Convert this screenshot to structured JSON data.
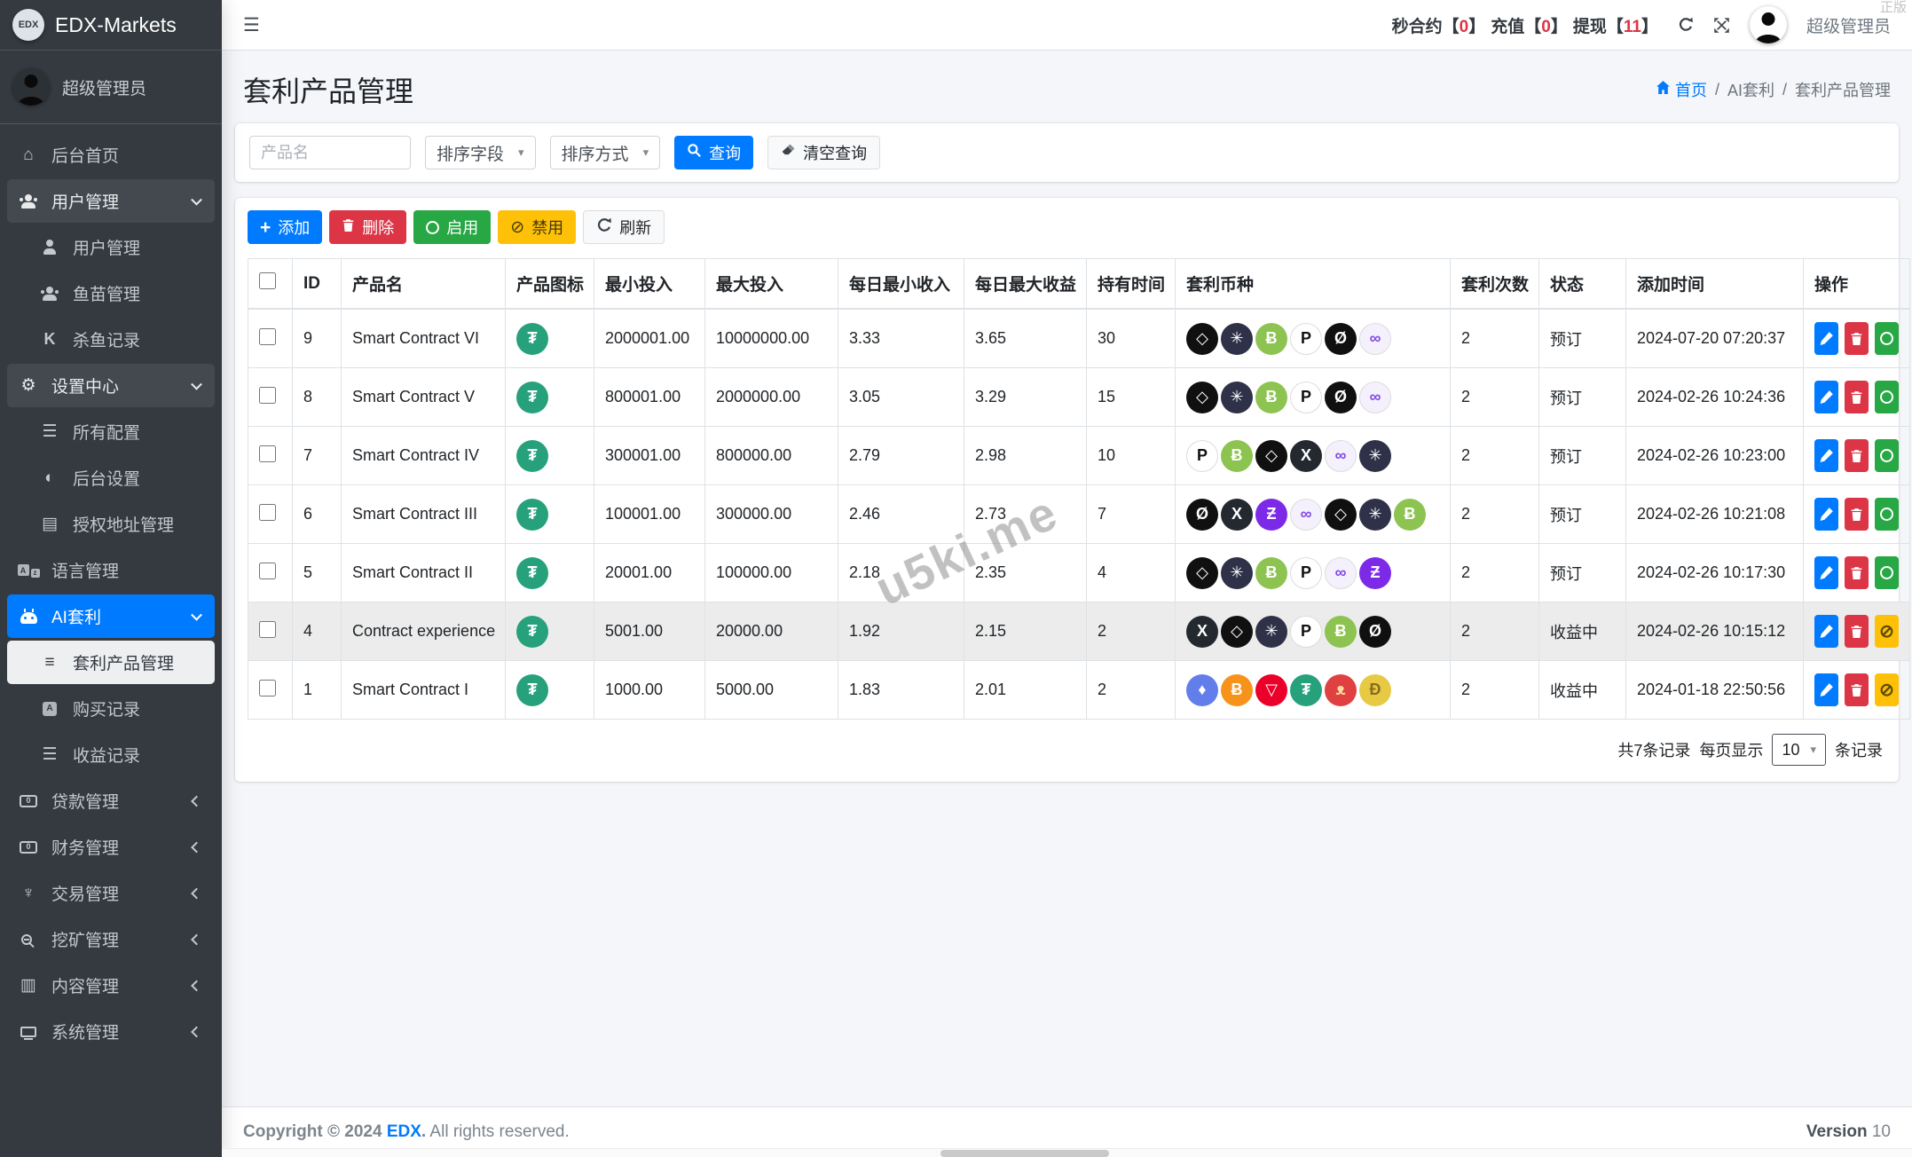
{
  "sidebar": {
    "brand": {
      "logo": "EDX",
      "name": "EDX-Markets"
    },
    "user": "超级管理员",
    "items": [
      {
        "label": "后台首页",
        "icon": "home"
      },
      {
        "label": "用户管理",
        "icon": "people",
        "expanded": true,
        "children": [
          {
            "label": "用户管理",
            "icon": "person"
          },
          {
            "label": "鱼苗管理",
            "icon": "people"
          },
          {
            "label": "杀鱼记录",
            "icon": "k"
          }
        ]
      },
      {
        "label": "设置中心",
        "icon": "gear",
        "expanded": true,
        "children": [
          {
            "label": "所有配置",
            "icon": "thlist"
          },
          {
            "label": "后台设置",
            "icon": "adjust"
          },
          {
            "label": "授权地址管理",
            "icon": "card"
          }
        ]
      },
      {
        "label": "语言管理",
        "icon": "lang"
      },
      {
        "label": "AI套利",
        "icon": "robot",
        "expanded": true,
        "active": true,
        "children": [
          {
            "label": "套利产品管理",
            "icon": "lines",
            "active": true
          },
          {
            "label": "购买记录",
            "icon": "abox"
          },
          {
            "label": "收益记录",
            "icon": "listdots"
          }
        ]
      },
      {
        "label": "贷款管理",
        "icon": "money",
        "collapsed": true
      },
      {
        "label": "财务管理",
        "icon": "money",
        "collapsed": true
      },
      {
        "label": "交易管理",
        "icon": "trident",
        "collapsed": true
      },
      {
        "label": "挖矿管理",
        "icon": "mag",
        "collapsed": true
      },
      {
        "label": "内容管理",
        "icon": "news",
        "collapsed": true
      },
      {
        "label": "系统管理",
        "icon": "desktop",
        "collapsed": true
      }
    ]
  },
  "topbar": {
    "stats": [
      {
        "label": "秒合约",
        "value": "0"
      },
      {
        "label": "充值",
        "value": "0"
      },
      {
        "label": "提现",
        "value": "11"
      }
    ],
    "username": "超级管理员"
  },
  "watermarks": {
    "corner": "正版",
    "table": "u5ki.me"
  },
  "page": {
    "title": "套利产品管理",
    "breadcrumb": {
      "home": "首页",
      "section": "AI套利",
      "current": "套利产品管理"
    }
  },
  "filters": {
    "product_placeholder": "产品名",
    "sort_field": "排序字段",
    "sort_order": "排序方式",
    "search_label": "查询",
    "clear_label": "清空查询"
  },
  "toolbar": {
    "add": "添加",
    "delete": "删除",
    "enable": "启用",
    "disable": "禁用",
    "refresh": "刷新"
  },
  "table": {
    "headers": [
      "ID",
      "产品名",
      "产品图标",
      "最小投入",
      "最大投入",
      "每日最小收入",
      "每日最大收益",
      "持有时间",
      "套利币种",
      "套利次数",
      "状态",
      "添加时间",
      "操作"
    ],
    "product_icon": "usdt",
    "rows": [
      {
        "id": "9",
        "name": "Smart Contract VI",
        "min": "2000001.00",
        "max": "10000000.00",
        "daily_min": "3.33",
        "daily_max": "3.65",
        "hold": "30",
        "coins": [
          "eos",
          "atom",
          "bch",
          "dot",
          "xlm",
          "matic"
        ],
        "count": "2",
        "status": "预订",
        "toggle": "enable",
        "added": "2024-07-20 07:20:37",
        "highlight": false
      },
      {
        "id": "8",
        "name": "Smart Contract V",
        "min": "800001.00",
        "max": "2000000.00",
        "daily_min": "3.05",
        "daily_max": "3.29",
        "hold": "15",
        "coins": [
          "eos",
          "atom",
          "bch",
          "dot",
          "xlm",
          "matic"
        ],
        "count": "2",
        "status": "预订",
        "toggle": "enable",
        "added": "2024-02-26 10:24:36",
        "highlight": false
      },
      {
        "id": "7",
        "name": "Smart Contract IV",
        "min": "300001.00",
        "max": "800000.00",
        "daily_min": "2.79",
        "daily_max": "2.98",
        "hold": "10",
        "coins": [
          "dot",
          "bch",
          "eos",
          "xrp",
          "matic",
          "atom"
        ],
        "count": "2",
        "status": "预订",
        "toggle": "enable",
        "added": "2024-02-26 10:23:00",
        "highlight": false
      },
      {
        "id": "6",
        "name": "Smart Contract III",
        "min": "100001.00",
        "max": "300000.00",
        "daily_min": "2.46",
        "daily_max": "2.73",
        "hold": "7",
        "coins": [
          "xlm",
          "xrp",
          "zec",
          "matic",
          "eos",
          "atom",
          "bch"
        ],
        "count": "2",
        "status": "预订",
        "toggle": "enable",
        "added": "2024-02-26 10:21:08",
        "highlight": false
      },
      {
        "id": "5",
        "name": "Smart Contract II",
        "min": "20001.00",
        "max": "100000.00",
        "daily_min": "2.18",
        "daily_max": "2.35",
        "hold": "4",
        "coins": [
          "eos",
          "atom",
          "bch",
          "dot",
          "matic",
          "zec"
        ],
        "count": "2",
        "status": "预订",
        "toggle": "enable",
        "added": "2024-02-26 10:17:30",
        "highlight": false
      },
      {
        "id": "4",
        "name": "Contract experience",
        "min": "5001.00",
        "max": "20000.00",
        "daily_min": "1.92",
        "daily_max": "2.15",
        "hold": "2",
        "coins": [
          "xrp",
          "eos",
          "atom",
          "dot",
          "bch",
          "xlm"
        ],
        "count": "2",
        "status": "收益中",
        "toggle": "disable",
        "added": "2024-02-26 10:15:12",
        "highlight": true
      },
      {
        "id": "1",
        "name": "Smart Contract I",
        "min": "1000.00",
        "max": "5000.00",
        "daily_min": "1.83",
        "daily_max": "2.01",
        "hold": "2",
        "coins": [
          "eth",
          "btc",
          "trx",
          "usdt",
          "shib",
          "doge"
        ],
        "count": "2",
        "status": "收益中",
        "toggle": "disable",
        "added": "2024-01-18 22:50:56",
        "highlight": false
      }
    ]
  },
  "coins": {
    "eos": {
      "label": "EOS",
      "bg": "#101010",
      "fg": "#ffffff",
      "glyph": "◇"
    },
    "atom": {
      "label": "ATOM",
      "bg": "#2e3148",
      "fg": "#ffffff",
      "glyph": "✳"
    },
    "bch": {
      "label": "BCH",
      "bg": "#8dc351",
      "fg": "#ffffff",
      "glyph": "Ƀ"
    },
    "dot": {
      "label": "DOT",
      "bg": "#ffffff",
      "fg": "#111111",
      "glyph": "P",
      "border": "#dcdcdc"
    },
    "xlm": {
      "label": "XLM",
      "bg": "#101010",
      "fg": "#ffffff",
      "glyph": "Ø"
    },
    "matic": {
      "label": "MATIC",
      "bg": "#f4f1fd",
      "fg": "#8247e5",
      "glyph": "∞",
      "border": "#dcdcdc"
    },
    "xrp": {
      "label": "XRP",
      "bg": "#23292f",
      "fg": "#ffffff",
      "glyph": "X"
    },
    "zec": {
      "label": "ZEC",
      "bg": "#7d2ae8",
      "fg": "#ffffff",
      "glyph": "Ƶ"
    },
    "eth": {
      "label": "ETH",
      "bg": "#627eea",
      "fg": "#ffffff",
      "glyph": "♦"
    },
    "btc": {
      "label": "BTC",
      "bg": "#f7931a",
      "fg": "#ffffff",
      "glyph": "Ƀ"
    },
    "trx": {
      "label": "TRX",
      "bg": "#eb0029",
      "fg": "#ffffff",
      "glyph": "▽"
    },
    "usdt": {
      "label": "USDT",
      "bg": "#26a17b",
      "fg": "#ffffff",
      "glyph": "₮"
    },
    "shib": {
      "label": "SHIB",
      "bg": "#e0403f",
      "fg": "#ffd9a0",
      "glyph": "ᴥ"
    },
    "doge": {
      "label": "DOGE",
      "bg": "#e7c944",
      "fg": "#8a6d1d",
      "glyph": "Ð"
    }
  },
  "pagination": {
    "total": "共7条记录",
    "per_page_prefix": "每页显示",
    "per_page": "10",
    "per_page_suffix": "条记录"
  },
  "footer": {
    "copyright_prefix": "Copyright © 2024",
    "brand": "EDX",
    "copyright_suffix": ".",
    "rights": "All rights reserved.",
    "version_label": "Version",
    "version": "10"
  }
}
